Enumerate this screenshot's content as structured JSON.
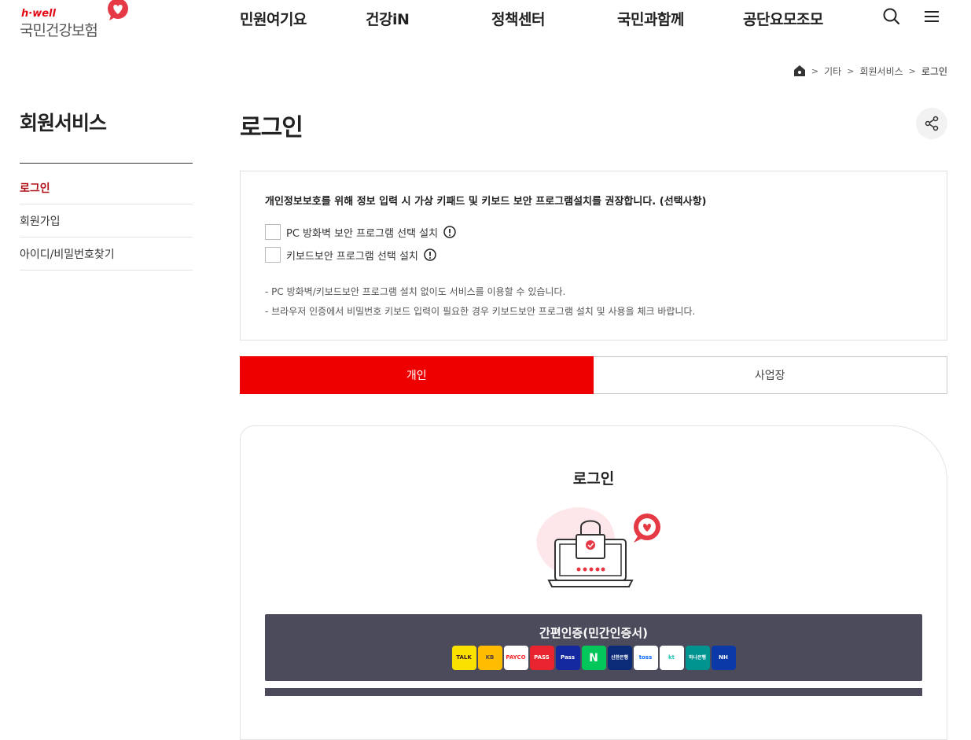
{
  "header": {
    "logo_small": "h·well",
    "logo_name": "국민건강보험",
    "nav": [
      "민원여기요",
      "건강iN",
      "정책센터",
      "국민과함께",
      "공단요모조모"
    ],
    "search_icon": "search-icon",
    "menu_icon": "hamburger-menu-icon"
  },
  "breadcrumb": {
    "home_icon": "home-icon",
    "items": [
      "기타",
      "회원서비스",
      "로그인"
    ]
  },
  "sidebar": {
    "title": "회원서비스",
    "items": [
      {
        "label": "로그인",
        "active": true
      },
      {
        "label": "회원가입",
        "active": false
      },
      {
        "label": "아이디/비밀번호찾기",
        "active": false
      }
    ]
  },
  "page": {
    "title": "로그인",
    "share_icon": "share-icon"
  },
  "notice": {
    "headline": "개인정보보호를 위해 정보 입력 시 가상 키패드 및 키보드 보안 프로그램설치를 권장합니다. (선택사항)",
    "options": [
      "PC 방화벽 보안 프로그램 선택 설치",
      "키보드보안 프로그램 선택 설치"
    ],
    "notes": [
      "- PC 방화벽/키보드보안 프로그램 설치 없이도 서비스를 이용할 수 있습니다.",
      "- 브라우저 인증에서 비밀번호 키보드 입력이 필요한 경우 키보드보안 프로그램 설치 및 사용을 체크 바랍니다."
    ]
  },
  "tabs": [
    "개인",
    "사업장"
  ],
  "login_card": {
    "title": "로그인",
    "simple_auth_title": "간편인증(민간인증서)",
    "providers": [
      {
        "name": "TALK",
        "color": "#fae100",
        "text_color": "#3c1e1e"
      },
      {
        "name": "KB",
        "color": "#ffbc00",
        "text_color": "#54433a"
      },
      {
        "name": "PAYCO",
        "color": "#ffffff",
        "text_color": "#fa2828"
      },
      {
        "name": "PASS",
        "color": "#e8242f",
        "text_color": "#ffffff"
      },
      {
        "name": "Pass",
        "color": "#1428a0",
        "text_color": "#ffffff"
      },
      {
        "name": "N",
        "color": "#03c75a",
        "text_color": "#ffffff"
      },
      {
        "name": "신한은행",
        "color": "#0b2b79",
        "text_color": "#ffffff"
      },
      {
        "name": "toss",
        "color": "#ffffff",
        "text_color": "#0064ff"
      },
      {
        "name": "kt",
        "color": "#ffffff",
        "text_color": "#20c4b4"
      },
      {
        "name": "하나은행",
        "color": "#009490",
        "text_color": "#ffffff"
      },
      {
        "name": "NH",
        "color": "#0b3aa8",
        "text_color": "#ffffff"
      }
    ]
  },
  "colors": {
    "brand_red": "#ee0000",
    "active_nav": "#b01119",
    "auth_bg": "#4b4b5c"
  }
}
